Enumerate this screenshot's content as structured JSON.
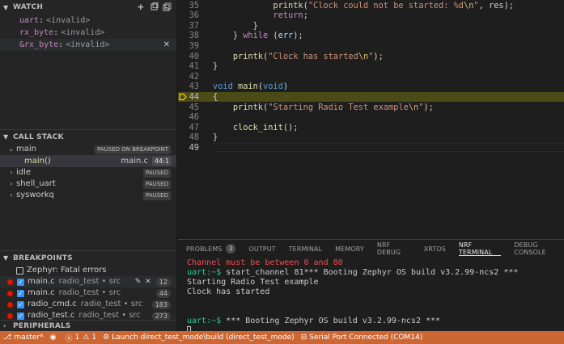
{
  "watch": {
    "title": "WATCH",
    "items": [
      {
        "name": "uart",
        "value": "<invalid>"
      },
      {
        "name": "rx_byte",
        "value": "<invalid>"
      },
      {
        "name": "&rx_byte",
        "value": "<invalid>"
      }
    ]
  },
  "callstack": {
    "title": "CALL STACK",
    "threads": [
      {
        "name": "main",
        "status": "PAUSED ON BREAKPOINT"
      },
      {
        "name": "idle",
        "status": "PAUSED"
      },
      {
        "name": "shell_uart",
        "status": "PAUSED"
      },
      {
        "name": "sysworkq",
        "status": "PAUSED"
      }
    ],
    "frame": {
      "function": "main()",
      "file": "main.c",
      "position": "44:1"
    }
  },
  "breakpoints": {
    "title": "BREAKPOINTS",
    "exception": "Zephyr: Fatal errors",
    "items": [
      {
        "file": "main.c",
        "path": "radio_test • src",
        "line": "12"
      },
      {
        "file": "main.c",
        "path": "radio_test • src",
        "line": "44"
      },
      {
        "file": "radio_cmd.c",
        "path": "radio_test • src",
        "line": "183"
      },
      {
        "file": "radio_test.c",
        "path": "radio_test • src",
        "line": "273"
      }
    ]
  },
  "peripherals": {
    "title": "PERIPHERALS"
  },
  "editor": {
    "lines": [
      {
        "n": "35",
        "indent": "            ",
        "tokens": [
          [
            "fn",
            "printk"
          ],
          [
            "txt",
            "("
          ],
          [
            "str",
            "\"Clock could not be started: %d"
          ],
          [
            "esc",
            "\\n"
          ],
          [
            "str",
            "\""
          ],
          [
            "txt",
            ", res);"
          ]
        ]
      },
      {
        "n": "36",
        "indent": "            ",
        "tokens": [
          [
            "ctrl",
            "return"
          ],
          [
            "txt",
            ";"
          ]
        ]
      },
      {
        "n": "37",
        "indent": "        ",
        "tokens": [
          [
            "txt",
            "}"
          ]
        ]
      },
      {
        "n": "38",
        "indent": "    ",
        "tokens": [
          [
            "txt",
            "} "
          ],
          [
            "ctrl",
            "while"
          ],
          [
            "txt",
            " ("
          ],
          [
            "var",
            "err"
          ],
          [
            "txt",
            ");"
          ]
        ]
      },
      {
        "n": "39",
        "indent": "",
        "tokens": []
      },
      {
        "n": "40",
        "indent": "    ",
        "tokens": [
          [
            "fn",
            "printk"
          ],
          [
            "txt",
            "("
          ],
          [
            "str",
            "\"Clock has started"
          ],
          [
            "esc",
            "\\n"
          ],
          [
            "str",
            "\""
          ],
          [
            "txt",
            ");"
          ]
        ]
      },
      {
        "n": "41",
        "indent": "",
        "tokens": [
          [
            "txt",
            "}"
          ]
        ]
      },
      {
        "n": "42",
        "indent": "",
        "tokens": []
      },
      {
        "n": "43",
        "indent": "",
        "tokens": [
          [
            "kw",
            "void"
          ],
          [
            "txt",
            " "
          ],
          [
            "fn",
            "main"
          ],
          [
            "txt",
            "("
          ],
          [
            "kw",
            "void"
          ],
          [
            "txt",
            ")"
          ]
        ]
      },
      {
        "n": "44",
        "indent": "",
        "tokens": [
          [
            "txt",
            "{"
          ]
        ]
      },
      {
        "n": "45",
        "indent": "    ",
        "tokens": [
          [
            "fn",
            "printk"
          ],
          [
            "txt",
            "("
          ],
          [
            "str",
            "\"Starting Radio Test example"
          ],
          [
            "esc",
            "\\n"
          ],
          [
            "str",
            "\""
          ],
          [
            "txt",
            ");"
          ]
        ]
      },
      {
        "n": "46",
        "indent": "",
        "tokens": []
      },
      {
        "n": "47",
        "indent": "    ",
        "tokens": [
          [
            "fn",
            "clock_init"
          ],
          [
            "txt",
            "();"
          ]
        ]
      },
      {
        "n": "48",
        "indent": "",
        "tokens": [
          [
            "txt",
            "}"
          ]
        ]
      },
      {
        "n": "49",
        "indent": "",
        "tokens": []
      }
    ],
    "highlighted_line": "44",
    "cursor_line": "49"
  },
  "panel": {
    "tabs": [
      {
        "label": "PROBLEMS",
        "count": "2"
      },
      {
        "label": "OUTPUT"
      },
      {
        "label": "TERMINAL"
      },
      {
        "label": "MEMORY"
      },
      {
        "label": "NRF DEBUG"
      },
      {
        "label": "XRTOS"
      },
      {
        "label": "NRF TERMINAL",
        "active": true
      },
      {
        "label": "DEBUG CONSOLE"
      }
    ],
    "terminal_lines": [
      {
        "type": "err",
        "text": "Channel must be between 0 and 80"
      },
      {
        "type": "prompt",
        "prompt": "uart:~$",
        "text": " start_channel 81*** Booting Zephyr OS build v3.2.99-ncs2 ***"
      },
      {
        "type": "plain",
        "text": "Starting Radio Test example"
      },
      {
        "type": "plain",
        "text": "Clock has started"
      },
      {
        "type": "plain",
        "text": ""
      },
      {
        "type": "plain",
        "text": ""
      },
      {
        "type": "prompt",
        "prompt": "uart:~$",
        "text": " *** Booting Zephyr OS build v3.2.99-ncs2 ***"
      },
      {
        "type": "cursor",
        "text": ""
      }
    ]
  },
  "statusbar": {
    "branch": "master*",
    "errors": "1",
    "warnings": "1",
    "launch": "Launch direct_test_mode\\build (direct_test_mode)",
    "serial": "Serial Port Connected (COM14)",
    "color": "#cc6633"
  }
}
